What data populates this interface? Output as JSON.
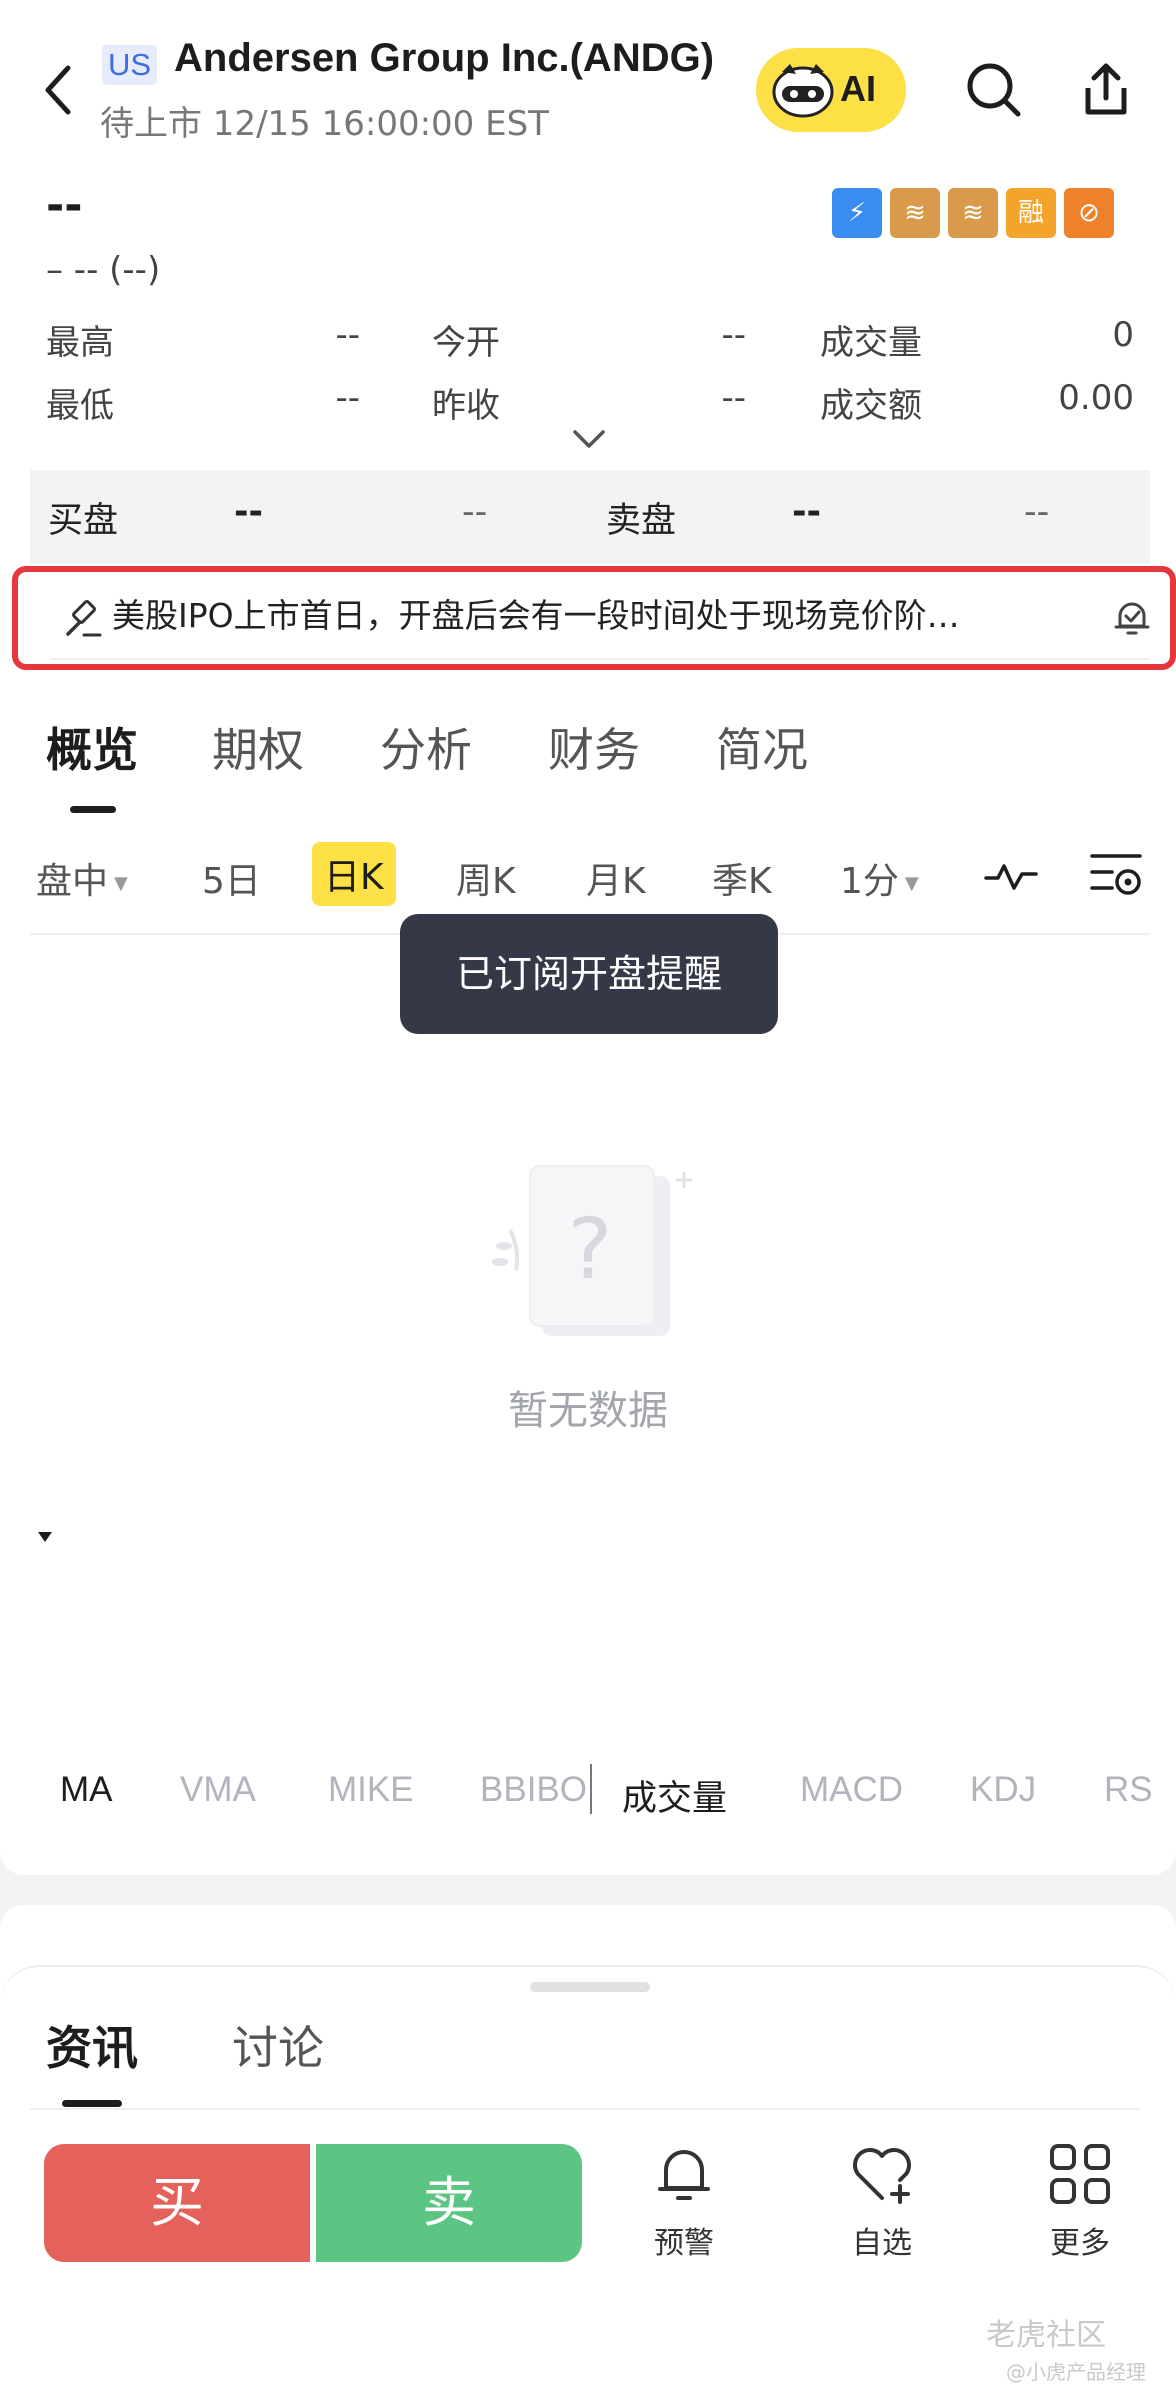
{
  "header": {
    "market_badge": "US",
    "title": "Andersen Group Inc.(ANDG)",
    "subtitle": "待上市 12/15 16:00:00 EST",
    "ai_label": "AI"
  },
  "quote": {
    "price": "--",
    "change": "– -- (--)",
    "tags": [
      {
        "name": "flash-tag",
        "glyph": "⚡",
        "color": "#3b8cf0"
      },
      {
        "name": "layers-a-tag",
        "glyph": "≋",
        "color": "#d99a4c"
      },
      {
        "name": "layers-t-tag",
        "glyph": "≋",
        "color": "#d99a4c"
      },
      {
        "name": "margin-tag",
        "glyph": "融",
        "color": "#f4a42b"
      },
      {
        "name": "no-short-tag",
        "glyph": "⊘",
        "color": "#f0812b"
      }
    ],
    "stats": {
      "high_label": "最高",
      "high_value": "--",
      "open_label": "今开",
      "open_value": "--",
      "volume_label": "成交量",
      "volume_value": "0",
      "low_label": "最低",
      "low_value": "--",
      "prev_close_label": "昨收",
      "prev_close_value": "--",
      "turnover_label": "成交额",
      "turnover_value": "0.00"
    }
  },
  "orderbook": {
    "bid_label": "买盘",
    "bid_price": "--",
    "bid_size": "--",
    "ask_label": "卖盘",
    "ask_price": "--",
    "ask_size": "--"
  },
  "notice": {
    "text": "美股IPO上市首日，开盘后会有一段时间处于现场竞价阶…"
  },
  "main_tabs": [
    "概览",
    "期权",
    "分析",
    "财务",
    "简况"
  ],
  "kline_tabs": {
    "intraday": "盘中",
    "five_day": "5日",
    "daily": "日K",
    "weekly": "周K",
    "monthly": "月K",
    "quarterly": "季K",
    "minute": "1分"
  },
  "toast": "已订阅开盘提醒",
  "empty_state": "暂无数据",
  "indicators": [
    "MA",
    "VMA",
    "MIKE",
    "BBIBO",
    "成交量",
    "MACD",
    "KDJ",
    "RS"
  ],
  "lower_tabs": [
    "资讯",
    "讨论"
  ],
  "actions": {
    "buy": "买",
    "sell": "卖",
    "alert": "预警",
    "watchlist": "自选",
    "more": "更多"
  },
  "watermark": {
    "line1": "老虎社区",
    "line2": "@小虎产品经理"
  }
}
